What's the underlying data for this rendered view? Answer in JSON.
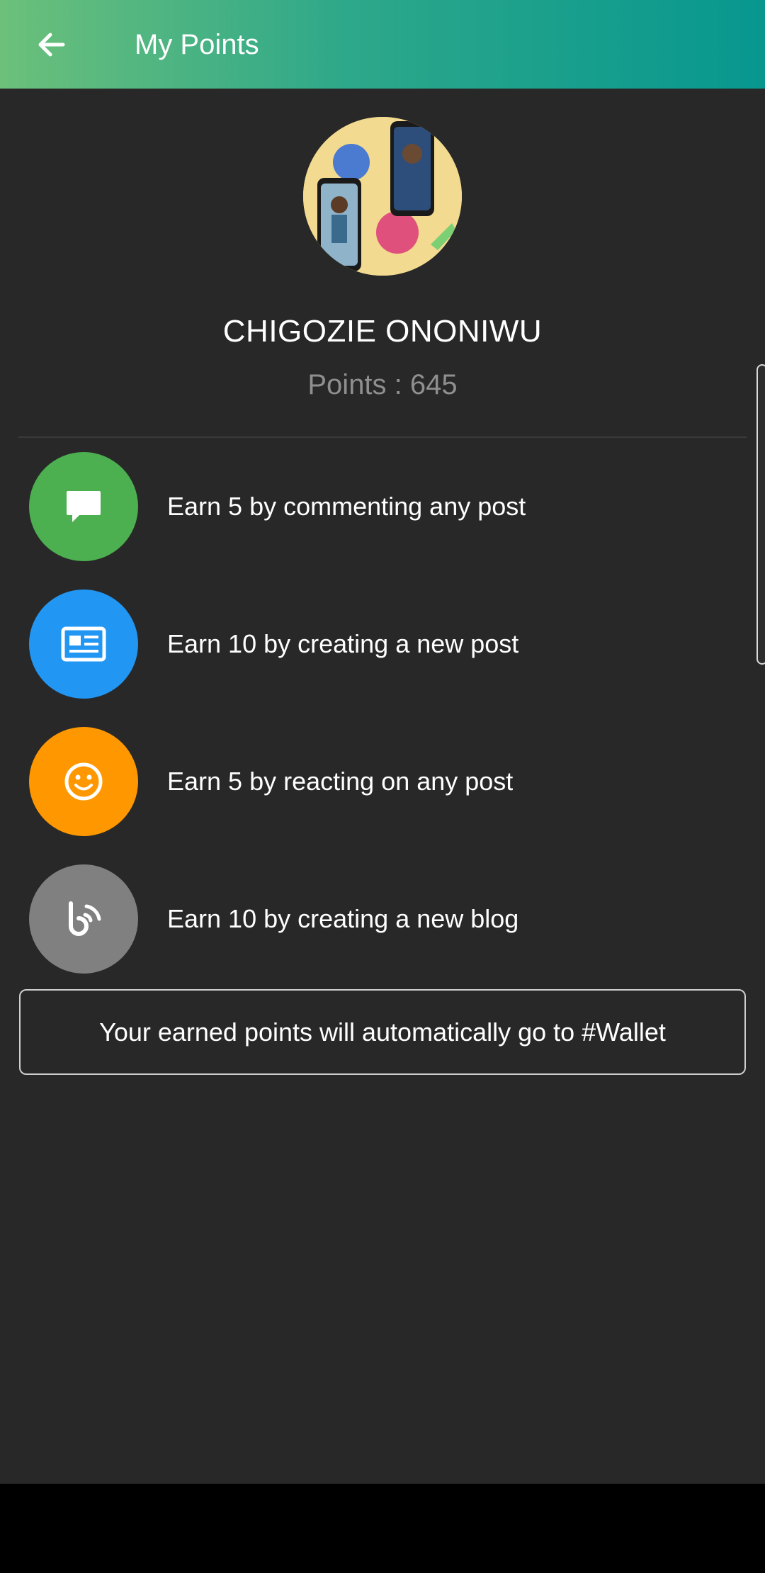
{
  "header": {
    "title": "My Points",
    "back_icon": "arrow-left-icon"
  },
  "profile": {
    "name": "CHIGOZIE ONONIWU",
    "points_text": "Points : 645"
  },
  "earn_items": [
    {
      "label": "Earn 5 by commenting any post",
      "icon": "comment-icon",
      "color": "#4caf50"
    },
    {
      "label": "Earn 10 by creating a new post",
      "icon": "newspaper-icon",
      "color": "#2196f3"
    },
    {
      "label": "Earn 5 by reacting on any post",
      "icon": "smiley-icon",
      "color": "#ff9800"
    },
    {
      "label": "Earn 10 by creating a new blog",
      "icon": "blog-icon",
      "color": "#808080"
    }
  ],
  "notice": "Your earned points will automatically go to #Wallet",
  "colors": {
    "header_gradient_start": "#6cc07a",
    "header_gradient_end": "#07978f",
    "background": "#282828"
  }
}
